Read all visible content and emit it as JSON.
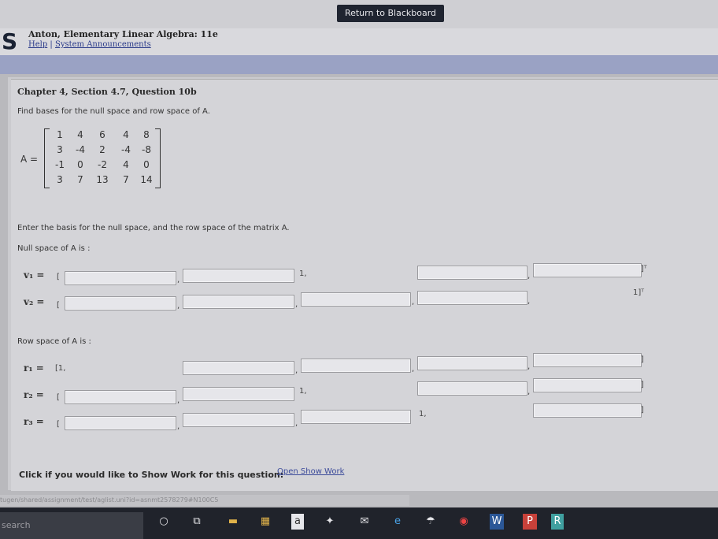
{
  "topbar": {
    "return_label": "Return to Blackboard"
  },
  "header": {
    "logo": "S",
    "course_title": "Anton, Elementary Linear Algebra: 11e",
    "help_link": "Help",
    "separator": " | ",
    "announcements_link": "System Announcements"
  },
  "question": {
    "title": "Chapter 4, Section 4.7, Question 10b",
    "prompt": "Find bases for the null space and row space of A.",
    "matrix_label": "A =",
    "matrix": [
      [
        "1",
        "4",
        "6",
        "4",
        "8"
      ],
      [
        "3",
        "-4",
        "2",
        "-4",
        "-8"
      ],
      [
        "-1",
        "0",
        "-2",
        "4",
        "0"
      ],
      [
        "3",
        "7",
        "13",
        "7",
        "14"
      ]
    ],
    "instruction": "Enter the basis for the null space, and the row space of the matrix A.",
    "null_space_label": "Null space of A is :",
    "row_space_label": "Row space of A is :",
    "v1_label": "v₁ =",
    "v2_label": "v₂ =",
    "r1_label": "r₁ =",
    "r2_label": "r₂ =",
    "r3_label": "r₃ =",
    "open_bracket": "[",
    "comma": ",",
    "one_comma": "1,",
    "r1_prefix": "[1,",
    "close_bracket": "]",
    "close_T": "]ᵀ",
    "one_close_T": "1]ᵀ"
  },
  "show_work": {
    "label": "Click if you would like to Show Work for this question:",
    "link": "Open Show Work"
  },
  "status_url": "tugen/shared/assignment/test/aglist.uni?id=asnmt2578279#N100C5",
  "taskbar": {
    "search": "search"
  }
}
